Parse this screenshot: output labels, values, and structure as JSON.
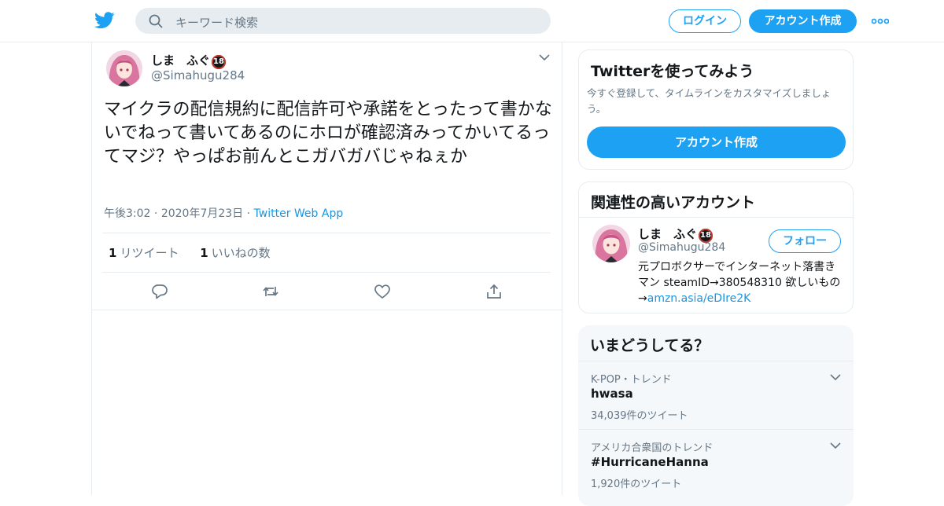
{
  "header": {
    "search_placeholder": "キーワード検索",
    "login_label": "ログイン",
    "signup_label": "アカウント作成"
  },
  "tweet": {
    "display_name": "しま　ふぐ",
    "badge": "18",
    "handle": "@Simahugu284",
    "text": "マイクラの配信規約に配信許可や承諾をとったって書かないでねって書いてあるのにホロが確認済みってかいてるってマジ？やっぱお前んとこガバガバじゃねぇか",
    "time": "午後3:02",
    "date": "2020年7月23日",
    "source": "Twitter Web App",
    "retweets_count": "1",
    "retweets_label": "リツイート",
    "likes_count": "1",
    "likes_label": "いいねの数"
  },
  "sidebar": {
    "signup_card": {
      "title": "Twitterを使ってみよう",
      "description": "今すぐ登録して、タイムラインをカスタマイズしましょう。",
      "button": "アカウント作成"
    },
    "related": {
      "title": "関連性の高いアカウント",
      "name": "しま　ふぐ",
      "badge": "18",
      "handle": "@Simahugu284",
      "follow_label": "フォロー",
      "bio": "元プロボクサーでインターネット落書きマン steamID→380548310 欲しいもの→",
      "bio_link": "amzn.asia/eDIre2K"
    },
    "trends": {
      "title": "いまどうしてる？",
      "items": [
        {
          "context": "K-POP・トレンド",
          "name": "hwasa",
          "count": "34,039件のツイート"
        },
        {
          "context": "アメリカ合衆国のトレンド",
          "name": "#HurricaneHanna",
          "count": "1,920件のツイート"
        }
      ]
    }
  },
  "colors": {
    "accent": "#1da1f2",
    "link": "#1b95e0",
    "muted": "#657786"
  },
  "icons": [
    "twitter-logo-icon",
    "search-icon",
    "more-dots-icon",
    "chevron-down-icon",
    "reply-icon",
    "retweet-icon",
    "like-icon",
    "share-icon"
  ]
}
